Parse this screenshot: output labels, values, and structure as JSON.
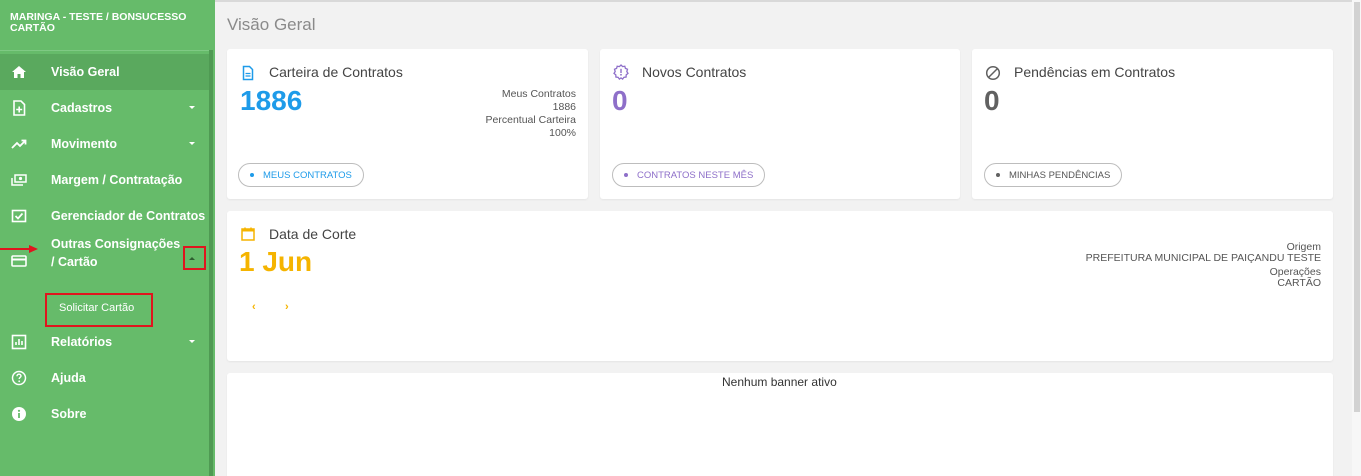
{
  "sidebar": {
    "header": "MARINGA - TESTE / BONSUCESSO CARTÃO",
    "items": [
      {
        "label": "Visão Geral",
        "icon": "home-icon"
      },
      {
        "label": "Cadastros",
        "icon": "add-document-icon"
      },
      {
        "label": "Movimento",
        "icon": "trending-up-icon"
      },
      {
        "label": "Margem / Contratação",
        "icon": "money-icon"
      },
      {
        "label": "Gerenciador de Contratos",
        "icon": "checklist-icon"
      },
      {
        "label": "Outras Consignações / Cartão",
        "icon": "credit-card-icon"
      },
      {
        "label": "Relatórios",
        "icon": "bar-chart-icon"
      },
      {
        "label": "Ajuda",
        "icon": "help-circle-icon"
      },
      {
        "label": "Sobre",
        "icon": "info-icon"
      }
    ],
    "subitem": "Solicitar Cartão"
  },
  "page": {
    "title": "Visão Geral"
  },
  "cards": {
    "carteira": {
      "title": "Carteira de Contratos",
      "value": "1886",
      "meta_label_1": "Meus Contratos",
      "meta_value_1": "1886",
      "meta_label_2": "Percentual Carteira",
      "meta_value_2": "100%",
      "button": "MEUS CONTRATOS",
      "color": "#1e9be9"
    },
    "novos": {
      "title": "Novos Contratos",
      "value": "0",
      "button": "CONTRATOS NESTE MÊS",
      "color": "#8e6fc9"
    },
    "pendencias": {
      "title": "Pendências em Contratos",
      "value": "0",
      "button": "MINHAS PENDÊNCIAS",
      "color": "#616161"
    },
    "corte": {
      "title": "Data de Corte",
      "value": "1 Jun",
      "origem_label": "Origem",
      "origem_value": "PREFEITURA MUNICIPAL DE PAIÇANDU TESTE",
      "operacoes_label": "Operações",
      "operacoes_value": "CARTÃO",
      "prev": "‹",
      "next": "›",
      "color": "#f5b400"
    }
  },
  "banner": {
    "text": "Nenhum banner ativo"
  }
}
